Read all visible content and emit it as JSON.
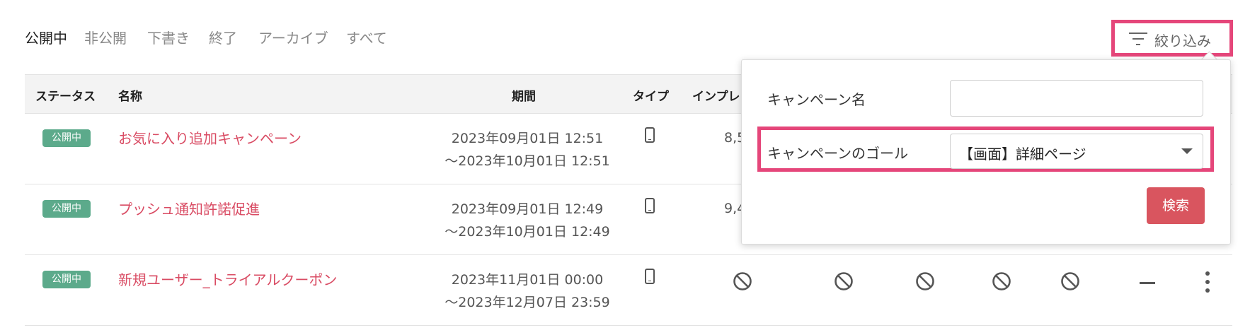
{
  "tabs": [
    "公開中",
    "非公開",
    "下書き",
    "終了",
    "アーカイブ",
    "すべて"
  ],
  "filter_button": {
    "label": "絞り込み",
    "icon": "filter-icon"
  },
  "table": {
    "headers": {
      "status": "ステータス",
      "name": "名称",
      "period": "期間",
      "type": "タイプ",
      "impressions": "インプレ"
    },
    "rows": [
      {
        "status": "公開中",
        "name": "お気に入り追加キャンペーン",
        "period_start": "2023年09月01日 12:51",
        "period_end": "〜2023年10月01日 12:51",
        "type_icon": "smartphone-icon",
        "impressions": "8,5"
      },
      {
        "status": "公開中",
        "name": "プッシュ通知許諾促進",
        "period_start": "2023年09月01日 12:49",
        "period_end": "〜2023年10月01日 12:49",
        "type_icon": "smartphone-icon",
        "impressions": "9,4"
      },
      {
        "status": "公開中",
        "name": "新規ユーザー_トライアルクーポン",
        "period_start": "2023年11月01日 00:00",
        "period_end": "〜2023年12月07日 23:59",
        "type_icon": "smartphone-icon",
        "metric_icons": [
          "prohibited-icon",
          "prohibited-icon",
          "prohibited-icon",
          "prohibited-icon",
          "prohibited-icon"
        ],
        "dash": "—"
      }
    ]
  },
  "filter_panel": {
    "campaign_name_label": "キャンペーン名",
    "campaign_name_value": "",
    "goal_label": "キャンペーンのゴール",
    "goal_value": "【画面】詳細ページ",
    "search_button": "検索"
  },
  "colors": {
    "highlight": "#e5467a",
    "status_badge": "#5caa8b",
    "campaign_link": "#d94b63",
    "search_button": "#d9555f"
  }
}
